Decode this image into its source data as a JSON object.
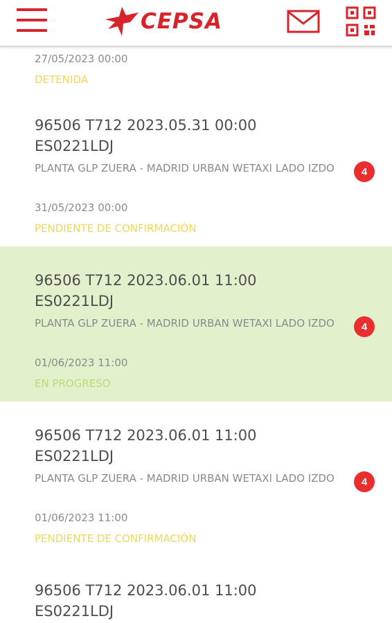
{
  "header": {
    "brand": "CEPSA",
    "brand_color": "#d8232a",
    "menu_icon": "hamburger-icon",
    "mail_icon": "envelope-icon",
    "qr_icon": "qr-code-icon"
  },
  "orders": [
    {
      "date": "27/05/2023 00:00",
      "status": "DETENIDA",
      "status_color": "#f1d65c"
    },
    {
      "title_line1": "96506 T712 2023.05.31 00:00",
      "title_line2": "ES0221LDJ",
      "route": "PLANTA GLP ZUERA - MADRID URBAN WETAXI LADO IZDO",
      "date": "31/05/2023 00:00",
      "status": "PENDIENTE DE CONFIRMACIÓN",
      "status_color": "#f1d65c",
      "badge": "4",
      "highlighted": false
    },
    {
      "title_line1": "96506 T712 2023.06.01 11:00",
      "title_line2": "ES0221LDJ",
      "route": "PLANTA GLP ZUERA - MADRID URBAN WETAXI LADO IZDO",
      "date": "01/06/2023 11:00",
      "status": "EN PROGRESO",
      "status_color": "#b9dc76",
      "badge": "4",
      "highlighted": true,
      "highlight_color": "#e2f0cc"
    },
    {
      "title_line1": "96506 T712 2023.06.01 11:00",
      "title_line2": "ES0221LDJ",
      "route": "PLANTA GLP ZUERA - MADRID URBAN WETAXI LADO IZDO",
      "date": "01/06/2023 11:00",
      "status": "PENDIENTE DE CONFIRMACIÓN",
      "status_color": "#f1d65c",
      "badge": "4",
      "highlighted": false
    },
    {
      "title_line1": "96506 T712 2023.06.01 11:00",
      "title_line2": "ES0221LDJ"
    }
  ]
}
